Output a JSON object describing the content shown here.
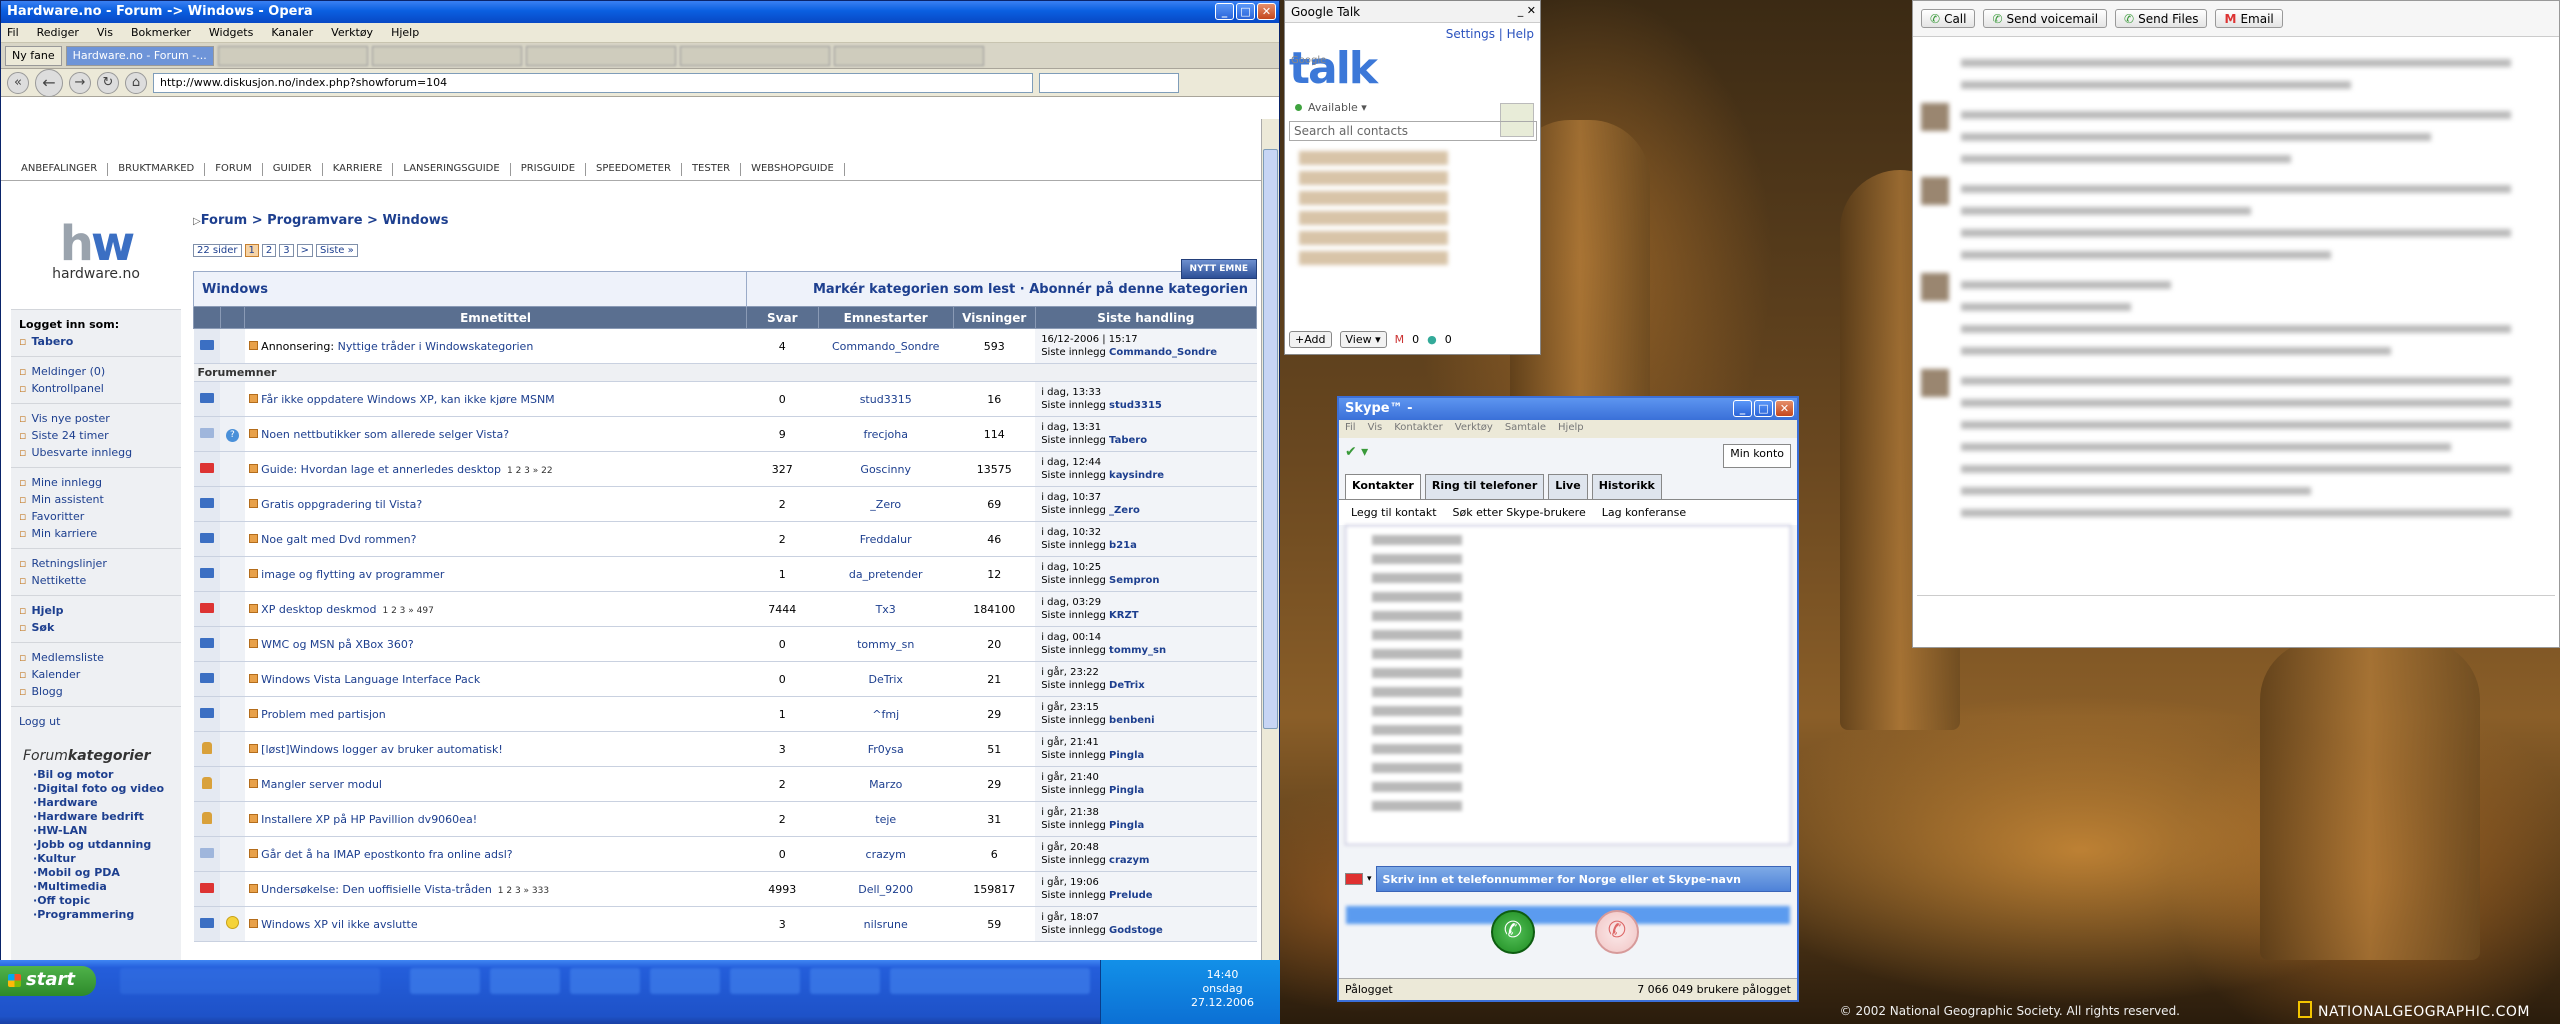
{
  "opera": {
    "title": "Hardware.no - Forum -> Windows - Opera",
    "menu": [
      "Fil",
      "Rediger",
      "Vis",
      "Bokmerker",
      "Widgets",
      "Kanaler",
      "Verktøy",
      "Hjelp"
    ],
    "tabs": [
      {
        "label": "Ny fane"
      },
      {
        "label": "Hardware.no - Forum -..."
      }
    ],
    "url": "http://www.diskusjon.no/index.php?showforum=104"
  },
  "site": {
    "nav": [
      "ANBEFALINGER",
      "BRUKTMARKED",
      "FORUM",
      "GUIDER",
      "KARRIERE",
      "LANSERINGSGUIDE",
      "PRISGUIDE",
      "SPEEDOMETER",
      "TESTER",
      "WEBSHOPGUIDE"
    ],
    "logo_text": "hardware.no",
    "logged_in_label": "Logget inn som:",
    "logged_in_user": "Tabero",
    "side_links_1": [
      "Meldinger (0)",
      "Kontrollpanel"
    ],
    "side_links_2": [
      "Vis nye poster",
      "Siste 24 timer",
      "Ubesvarte innlegg"
    ],
    "side_links_3": [
      "Mine innlegg",
      "Min assistent",
      "Favoritter",
      "Min karriere"
    ],
    "side_links_4": [
      "Retningslinjer",
      "Nettikette"
    ],
    "side_links_5": [
      "Hjelp",
      "Søk"
    ],
    "side_links_6": [
      "Medlemsliste",
      "Kalender",
      "Blogg"
    ],
    "logout": "Logg ut",
    "forumkat_a": "Forum",
    "forumkat_b": "kategorier",
    "categories": [
      "Bil og motor",
      "Digital foto og video",
      "Hardware",
      "Hardware bedrift",
      "HW-LAN",
      "Jobb og utdanning",
      "Kultur",
      "Mobil og PDA",
      "Multimedia",
      "Off topic",
      "Programmering"
    ]
  },
  "forum": {
    "breadcrumb": "Forum > Programvare > Windows",
    "pages_label": "22 sider",
    "pages": [
      "1",
      "2",
      "3",
      ">",
      "Siste »"
    ],
    "new_topic": "NYTT EMNE",
    "section_title": "Windows",
    "section_actions": "Markér kategorien som lest · Abonnér på denne kategorien",
    "headers": [
      "Emnetittel",
      "Svar",
      "Emnestarter",
      "Visninger",
      "Siste handling"
    ],
    "announcement": {
      "prefix": "Annonsering:",
      "title": "Nyttige tråder i Windowskategorien",
      "replies": "4",
      "starter": "Commando_Sondre",
      "views": "593",
      "date": "16/12-2006 | 15:17",
      "last_by": "Commando_Sondre"
    },
    "topics_label": "Forumemner",
    "last_prefix": "Siste innlegg",
    "topics": [
      {
        "title": "Får ikke oppdatere Windows XP, kan ikke kjøre MSNM",
        "replies": "0",
        "starter": "stud3315",
        "views": "16",
        "date": "i dag, 13:33",
        "last_by": "stud3315",
        "icon": "folder"
      },
      {
        "title": "Noen nettbutikker som allerede selger Vista?",
        "replies": "9",
        "starter": "frecjoha",
        "views": "114",
        "date": "i dag, 13:31",
        "last_by": "Tabero",
        "icon": "folder-light"
      },
      {
        "title": "Guide: Hvordan lage et annerledes desktop",
        "pages": "1 2 3 » 22",
        "replies": "327",
        "starter": "Goscinny",
        "views": "13575",
        "date": "i dag, 12:44",
        "last_by": "kaysindre",
        "icon": "folder-hot"
      },
      {
        "title": "Gratis oppgradering til Vista?",
        "replies": "2",
        "starter": "_Zero",
        "views": "69",
        "date": "i dag, 10:37",
        "last_by": "_Zero",
        "icon": "folder"
      },
      {
        "title": "Noe galt med Dvd rommen?",
        "replies": "2",
        "starter": "Freddalur",
        "views": "46",
        "date": "i dag, 10:32",
        "last_by": "b21a",
        "icon": "folder"
      },
      {
        "title": "image og flytting av programmer",
        "replies": "1",
        "starter": "da_pretender",
        "views": "12",
        "date": "i dag, 10:25",
        "last_by": "Sempron",
        "icon": "folder"
      },
      {
        "title": "XP desktop deskmod",
        "pages": "1 2 3 » 497",
        "replies": "7444",
        "starter": "Tx3",
        "views": "184100",
        "date": "i dag, 03:29",
        "last_by": "KRZT",
        "icon": "folder-hot"
      },
      {
        "title": "WMC og MSN på XBox 360?",
        "replies": "0",
        "starter": "tommy_sn",
        "views": "20",
        "date": "i dag, 00:14",
        "last_by": "tommy_sn",
        "icon": "folder"
      },
      {
        "title": "Windows Vista Language Interface Pack",
        "replies": "0",
        "starter": "DeTrix",
        "views": "21",
        "date": "i går, 23:22",
        "last_by": "DeTrix",
        "icon": "folder"
      },
      {
        "title": "Problem med partisjon",
        "replies": "1",
        "starter": "^fmj",
        "views": "29",
        "date": "i går, 23:15",
        "last_by": "benbeni",
        "icon": "folder"
      },
      {
        "title": "[løst]Windows logger av bruker automatisk!",
        "replies": "3",
        "starter": "Fr0ysa",
        "views": "51",
        "date": "i går, 21:41",
        "last_by": "Pingla",
        "icon": "lock"
      },
      {
        "title": "Mangler server modul",
        "replies": "2",
        "starter": "Marzo",
        "views": "29",
        "date": "i går, 21:40",
        "last_by": "Pingla",
        "icon": "lock"
      },
      {
        "title": "Installere XP på HP Pavillion dv9060ea!",
        "replies": "2",
        "starter": "teje",
        "views": "31",
        "date": "i går, 21:38",
        "last_by": "Pingla",
        "icon": "lock"
      },
      {
        "title": "Går det å ha IMAP epostkonto fra online adsl?",
        "replies": "0",
        "starter": "crazym",
        "views": "6",
        "date": "i går, 20:48",
        "last_by": "crazym",
        "icon": "folder-light"
      },
      {
        "title": "Undersøkelse: Den uoffisielle Vista-tråden",
        "pages": "1 2 3 » 333",
        "replies": "4993",
        "starter": "Dell_9200",
        "views": "159817",
        "date": "i går, 19:06",
        "last_by": "Prelude",
        "icon": "folder-hot"
      },
      {
        "title": "Windows XP vil ikke avslutte",
        "replies": "3",
        "starter": "nilsrune",
        "views": "59",
        "date": "i går, 18:07",
        "last_by": "Godstoge",
        "icon": "folder"
      }
    ]
  },
  "taskbar": {
    "start": "start",
    "time": "14:40",
    "day": "onsdag",
    "date": "27.12.2006"
  },
  "gtalk": {
    "title": "Google Talk",
    "logo": "talk",
    "settings": "Settings",
    "help": "Help",
    "status": "Available ▾",
    "search_placeholder": "Search all contacts",
    "add": "+Add",
    "view": "View ▾",
    "mail_count": "0",
    "chat_count": "0"
  },
  "skype": {
    "title": "Skype™ -",
    "menu": [
      "Fil",
      "Vis",
      "Kontakter",
      "Verktøy",
      "Samtale",
      "Hjelp"
    ],
    "my_account": "Min konto",
    "tabs": [
      "Kontakter",
      "Ring til telefoner",
      "Live",
      "Historikk"
    ],
    "tools": [
      "Legg til kontakt",
      "Søk etter Skype-brukere",
      "Lag konferanse"
    ],
    "phone_placeholder": "Skriv inn et telefonnummer for Norge eller et Skype-navn",
    "status": "Pålogget",
    "online_users": "7 066 049 brukere pålogget"
  },
  "chat": {
    "buttons": [
      "Call",
      "Send voicemail",
      "Send Files",
      "Email"
    ]
  },
  "desktop": {
    "credit": "© 2002 National Geographic Society. All rights reserved.",
    "logo": "NATIONALGEOGRAPHIC.COM"
  }
}
